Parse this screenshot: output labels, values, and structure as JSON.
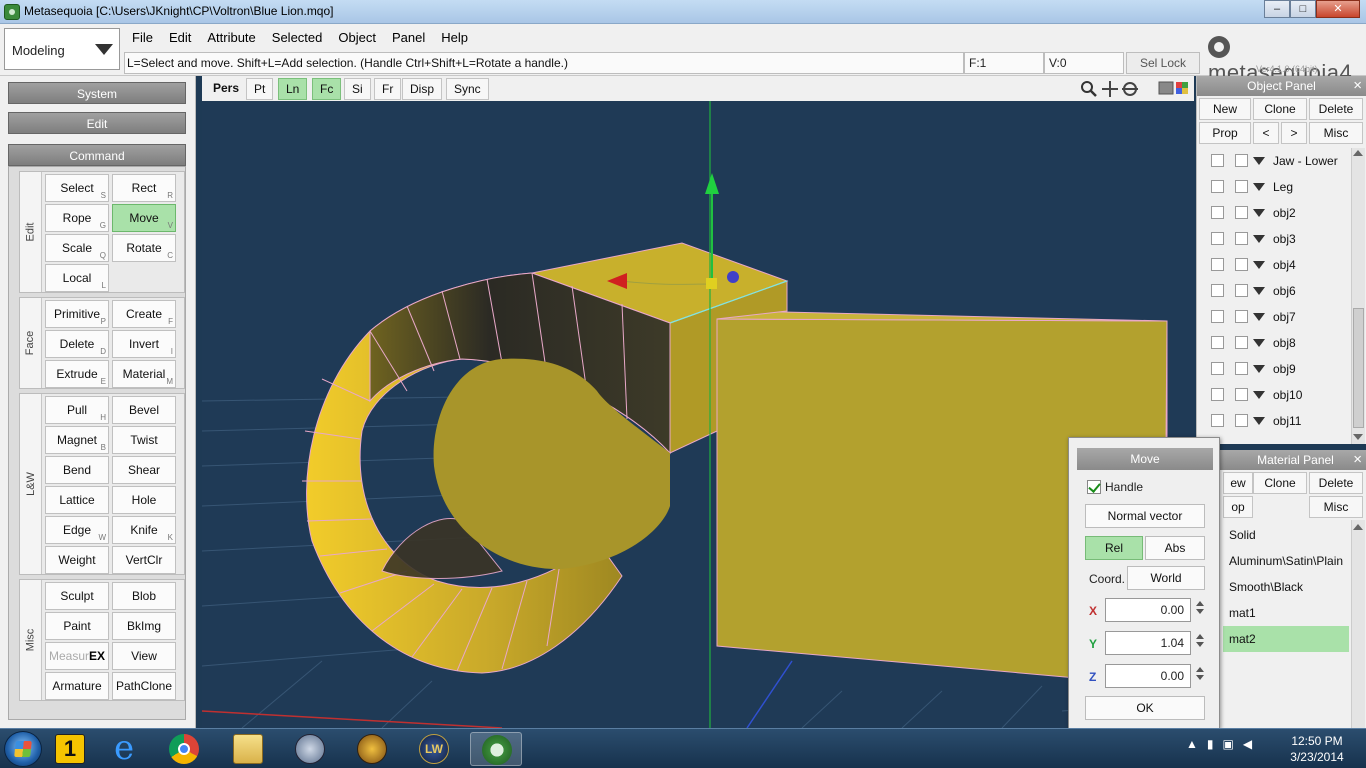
{
  "window": {
    "title": "Metasequoia [C:\\Users\\JKnight\\CP\\Voltron\\Blue Lion.mqo]",
    "minimize": "–",
    "maximize": "□",
    "close": "✕"
  },
  "mode": {
    "selected": "Modeling"
  },
  "menu": [
    "File",
    "Edit",
    "Attribute",
    "Selected",
    "Object",
    "Panel",
    "Help"
  ],
  "hint": "L=Select and move.  Shift+L=Add selection.  (Handle Ctrl+Shift+L=Rotate a handle.)",
  "status": {
    "faces": "F:1",
    "vertices": "V:0",
    "sel_lock": "Sel Lock"
  },
  "logo": {
    "name": "metasequoia4",
    "version": "Ver4.1.0 (64bit)"
  },
  "left": {
    "system": "System",
    "edit": "Edit",
    "command": "Command",
    "groups": {
      "edit": "Edit",
      "face": "Face",
      "lw": "L&W",
      "misc": "Misc"
    },
    "buttons": {
      "select": {
        "label": "Select",
        "key": "S"
      },
      "rect": {
        "label": "Rect",
        "key": "R"
      },
      "rope": {
        "label": "Rope",
        "key": "G"
      },
      "move": {
        "label": "Move",
        "key": "V"
      },
      "scale": {
        "label": "Scale",
        "key": "Q"
      },
      "rotate": {
        "label": "Rotate",
        "key": "C"
      },
      "local": {
        "label": "Local",
        "key": "L"
      },
      "primitive": {
        "label": "Primitive",
        "key": "P"
      },
      "create": {
        "label": "Create",
        "key": "F"
      },
      "delete": {
        "label": "Delete",
        "key": "D"
      },
      "invert": {
        "label": "Invert",
        "key": "I"
      },
      "extrude": {
        "label": "Extrude",
        "key": "E"
      },
      "material": {
        "label": "Material",
        "key": "M"
      },
      "pull": {
        "label": "Pull",
        "key": "H"
      },
      "bevel": {
        "label": "Bevel",
        "key": ""
      },
      "magnet": {
        "label": "Magnet",
        "key": "B"
      },
      "twist": {
        "label": "Twist",
        "key": ""
      },
      "bend": {
        "label": "Bend",
        "key": ""
      },
      "shear": {
        "label": "Shear",
        "key": ""
      },
      "lattice": {
        "label": "Lattice",
        "key": ""
      },
      "hole": {
        "label": "Hole",
        "key": ""
      },
      "edge": {
        "label": "Edge",
        "key": "W"
      },
      "knife": {
        "label": "Knife",
        "key": "K"
      },
      "weight": {
        "label": "Weight",
        "key": ""
      },
      "vertclr": {
        "label": "VertClr",
        "key": ""
      },
      "sculpt": {
        "label": "Sculpt",
        "key": ""
      },
      "blob": {
        "label": "Blob",
        "key": ""
      },
      "paint": {
        "label": "Paint",
        "key": ""
      },
      "bkimg": {
        "label": "BkImg",
        "key": ""
      },
      "measure": {
        "label": "Measur",
        "badge": "EX"
      },
      "view": {
        "label": "View",
        "key": ""
      },
      "armature": {
        "label": "Armature",
        "key": ""
      },
      "pathclone": {
        "label": "PathClone",
        "key": ""
      }
    }
  },
  "viewport": {
    "toolbar": [
      "Pers",
      "Pt",
      "Ln",
      "Fc",
      "Si",
      "Fr",
      "Disp",
      "Sync"
    ]
  },
  "object_panel": {
    "title": "Object Panel",
    "buttons": [
      "New",
      "Clone",
      "Delete",
      "Prop",
      "<",
      ">",
      "Misc"
    ],
    "objects": [
      "Jaw - Lower",
      "Leg",
      "obj2",
      "obj3",
      "obj4",
      "obj6",
      "obj7",
      "obj8",
      "obj9",
      "obj10",
      "obj11"
    ]
  },
  "material_panel": {
    "title": "Material Panel",
    "buttons": [
      "ew",
      "Clone",
      "Delete",
      "op",
      "Misc"
    ],
    "materials": [
      "Solid",
      "Aluminum\\Satin\\Plain",
      "Smooth\\Black",
      "mat1",
      "mat2"
    ],
    "selected": "mat2"
  },
  "move_dialog": {
    "title": "Move",
    "handle_label": "Handle",
    "normal_vector": "Normal vector",
    "rel": "Rel",
    "abs": "Abs",
    "coord_label": "Coord.",
    "coord_value": "World",
    "x_label": "X",
    "x": "0.00",
    "y_label": "Y",
    "y": "1.04",
    "z_label": "Z",
    "z": "0.00",
    "ok": "OK"
  },
  "taskbar": {
    "time": "12:50 PM",
    "date": "3/23/2014",
    "icons": [
      "start-icon",
      "one-icon",
      "ie-icon",
      "chrome-icon",
      "explorer-icon",
      "hp-icon",
      "wow-icon",
      "lw-icon",
      "metasequoia-icon"
    ],
    "one_label": "1",
    "lw_label": "LW",
    "ie_label": "e"
  },
  "colors": {
    "viewport_bg": "#1f3a56",
    "model": "#b5a22e",
    "active_green": "#a9e1a9"
  }
}
